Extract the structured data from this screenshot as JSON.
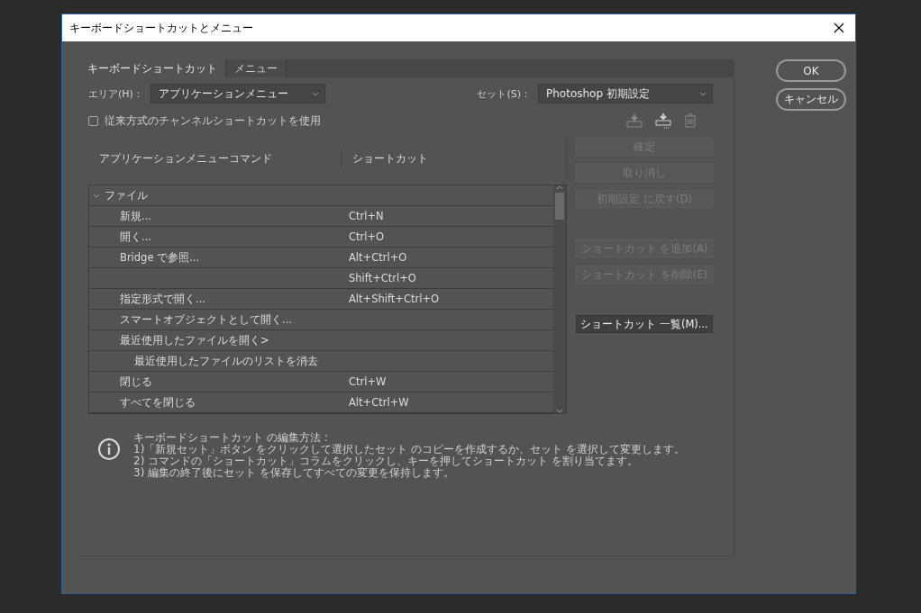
{
  "window": {
    "title": "キーボードショートカットとメニュー"
  },
  "tabs": [
    {
      "label": "キーボードショートカット",
      "selected": true
    },
    {
      "label": "メニュー",
      "selected": false
    }
  ],
  "area": {
    "label": "エリア(H)：",
    "value": "アプリケーションメニュー"
  },
  "set": {
    "label": "セット(S)：",
    "value": "Photoshop 初期設定"
  },
  "legacy_channel_shortcuts": {
    "label": "従来方式のチャンネルショートカットを使用",
    "checked": false
  },
  "columns": [
    "アプリケーションメニューコマンド",
    "ショートカット"
  ],
  "rows": [
    {
      "command": "ファイル",
      "expanded": true,
      "children": [
        {
          "command": "新規...",
          "shortcut": "Ctrl+N"
        },
        {
          "command": "開く...",
          "shortcut": "Ctrl+O"
        },
        {
          "command": "Bridge で参照...",
          "shortcut": "Alt+Ctrl+O"
        },
        {
          "shortcut": "Shift+Ctrl+O"
        },
        {
          "command": "指定形式で開く...",
          "shortcut": "Alt+Shift+Ctrl+O"
        },
        {
          "command": "スマートオブジェクトとして開く..."
        },
        {
          "command": "最近使用したファイルを開く>",
          "children": [
            {
              "command": "最近使用したファイルのリストを消去"
            }
          ]
        },
        {
          "command": "閉じる",
          "shortcut": "Ctrl+W"
        },
        {
          "command": "すべてを閉じる",
          "shortcut": "Alt+Ctrl+W"
        }
      ]
    }
  ],
  "side_button_groups": [
    [
      {
        "label": "確定",
        "disabled": true
      },
      {
        "label": "取り消し",
        "disabled": true
      },
      {
        "label": "初期設定 に戻す(D)",
        "disabled": true
      }
    ],
    [
      {
        "label": "ショートカット を追加(A)",
        "disabled": true
      },
      {
        "label": "ショートカット を削除(E)",
        "disabled": true
      }
    ],
    [
      {
        "label": "ショートカット 一覧(M)...",
        "disabled": false
      }
    ]
  ],
  "info": [
    "キーボードショートカット の編集方法 :",
    "1)「新規セット」ボタン をクリックして選択したセット のコピーを作成するか、セット を選択して変更します。",
    "2) コマンドの「ショートカット」コラムをクリックし、キーを押してショートカット を割り当てます。",
    "3) 編集の終了後にセット を保存してすべての変更を保持します。"
  ],
  "dialog_buttons": [
    "OK",
    "キャンセル"
  ]
}
